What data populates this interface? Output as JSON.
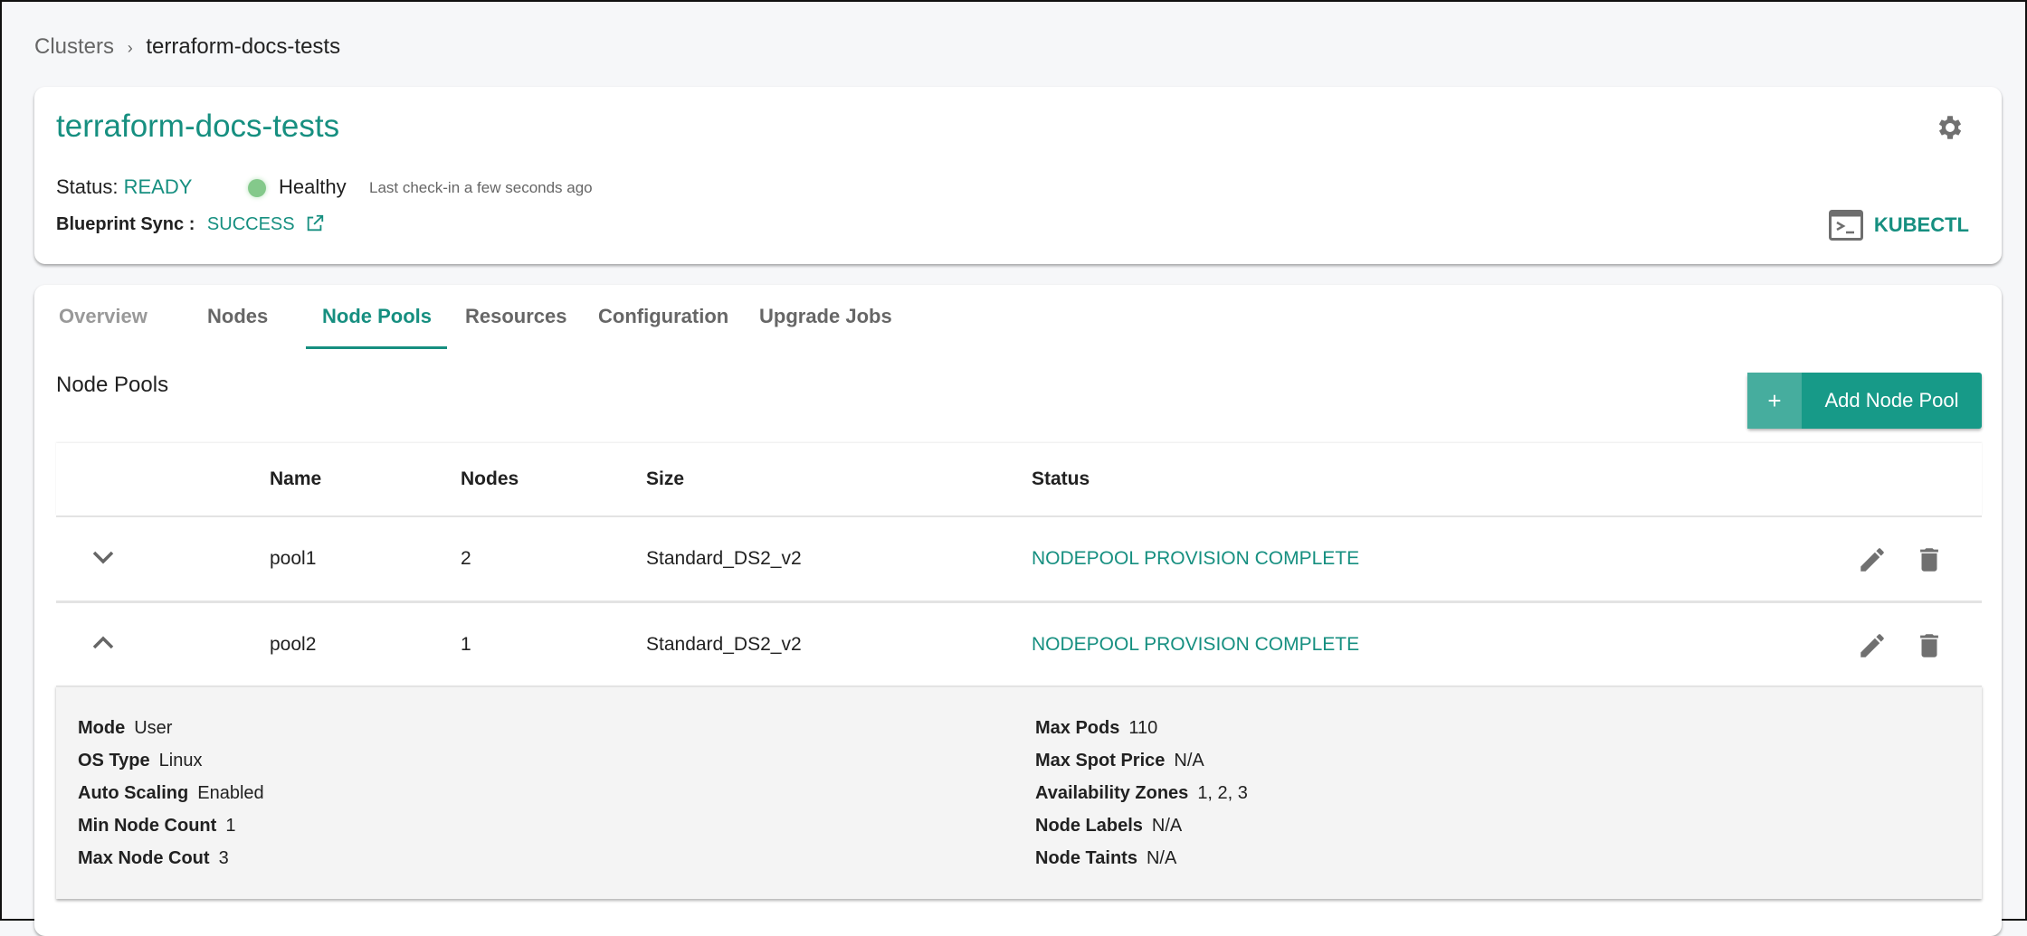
{
  "breadcrumb": {
    "root": "Clusters",
    "separator": "›",
    "current": "terraform-docs-tests"
  },
  "cluster": {
    "name": "terraform-docs-tests",
    "status_label": "Status:",
    "status": "READY",
    "health": "Healthy",
    "health_color": "#84c98b",
    "last_checkin": "Last check-in a few seconds ago",
    "blueprint_label": "Blueprint Sync :",
    "blueprint_status": "SUCCESS",
    "kubectl": "KUBECTL"
  },
  "tabs": [
    {
      "label": "Overview"
    },
    {
      "label": "Nodes"
    },
    {
      "label": "Node Pools",
      "active": true
    },
    {
      "label": "Resources"
    },
    {
      "label": "Configuration"
    },
    {
      "label": "Upgrade Jobs"
    }
  ],
  "section": {
    "title": "Node Pools",
    "add_button": "Add Node Pool",
    "add_icon": "+"
  },
  "table": {
    "headers": [
      "Name",
      "Nodes",
      "Size",
      "Status"
    ],
    "rows": [
      {
        "name": "pool1",
        "nodes": "2",
        "size": "Standard_DS2_v2",
        "status": "NODEPOOL PROVISION COMPLETE",
        "expanded": false
      },
      {
        "name": "pool2",
        "nodes": "1",
        "size": "Standard_DS2_v2",
        "status": "NODEPOOL PROVISION COMPLETE",
        "expanded": true
      }
    ]
  },
  "details": {
    "left": [
      {
        "k": "Mode",
        "v": "User"
      },
      {
        "k": "OS Type",
        "v": "Linux"
      },
      {
        "k": "Auto Scaling",
        "v": "Enabled"
      },
      {
        "k": "Min Node Count",
        "v": "1"
      },
      {
        "k": "Max Node Cout",
        "v": "3"
      }
    ],
    "right": [
      {
        "k": "Max Pods",
        "v": "110"
      },
      {
        "k": "Max Spot Price",
        "v": "N/A"
      },
      {
        "k": "Availability Zones",
        "v": "1, 2, 3"
      },
      {
        "k": "Node Labels",
        "v": "N/A"
      },
      {
        "k": "Node Taints",
        "v": "N/A"
      }
    ]
  },
  "colors": {
    "accent": "#168f80",
    "button": "#179a88"
  }
}
